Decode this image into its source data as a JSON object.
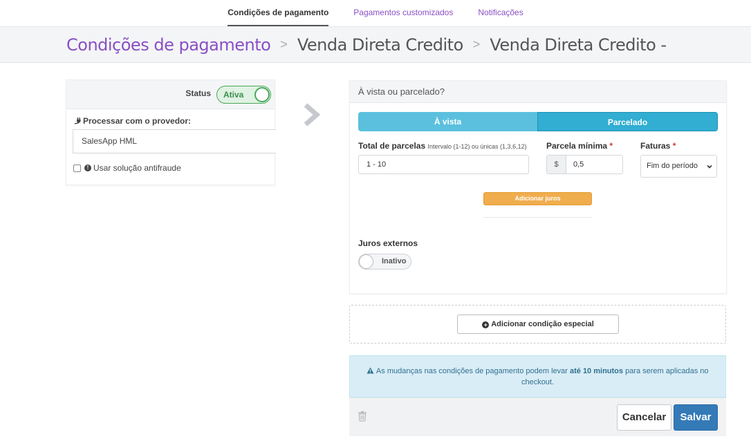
{
  "topnav": {
    "tabs": [
      "Condições de pagamento",
      "Pagamentos customizados",
      "Notificações"
    ]
  },
  "breadcrumb": {
    "items": [
      "Condições de pagamento",
      "Venda Direta Credito",
      "Venda Direta Credito -"
    ],
    "separator": ">"
  },
  "left": {
    "status_label": "Status",
    "status_value": "Ativa",
    "provider_label": "Processar com o provedor:",
    "provider_value": "SalesApp HML",
    "antifraud_label": "Usar solução antifraude"
  },
  "right": {
    "header": "À vista ou parcelado?",
    "seg_a_vista": "À vista",
    "seg_parcelado": "Parcelado",
    "parcelas_label": "Total de parcelas",
    "parcelas_hint": "Intervalo (1-12) ou únicas (1,3,6,12)",
    "parcelas_value": "1 - 10",
    "parcela_min_label": "Parcela mínima",
    "currency": "$",
    "parcela_min_value": "0,5",
    "faturas_label": "Faturas",
    "faturas_value": "Fim do período",
    "required_mark": "*",
    "add_juros": "Adicionar juros",
    "juros_ext_label": "Juros externos",
    "juros_ext_value": "Inativo"
  },
  "special": {
    "button": "Adicionar condição especial"
  },
  "alert": {
    "text_before": "As mudanças nas condições de pagamento podem levar ",
    "text_bold": "até 10 minutos",
    "text_after": " para serem aplicadas no checkout."
  },
  "footer": {
    "cancel": "Cancelar",
    "save": "Salvar"
  },
  "colors": {
    "brand_purple": "#8a4fc4",
    "success_green": "#49a85a",
    "info_blue": "#5bc0de",
    "warning_orange": "#f0ad4e",
    "primary_blue": "#337ab7"
  }
}
